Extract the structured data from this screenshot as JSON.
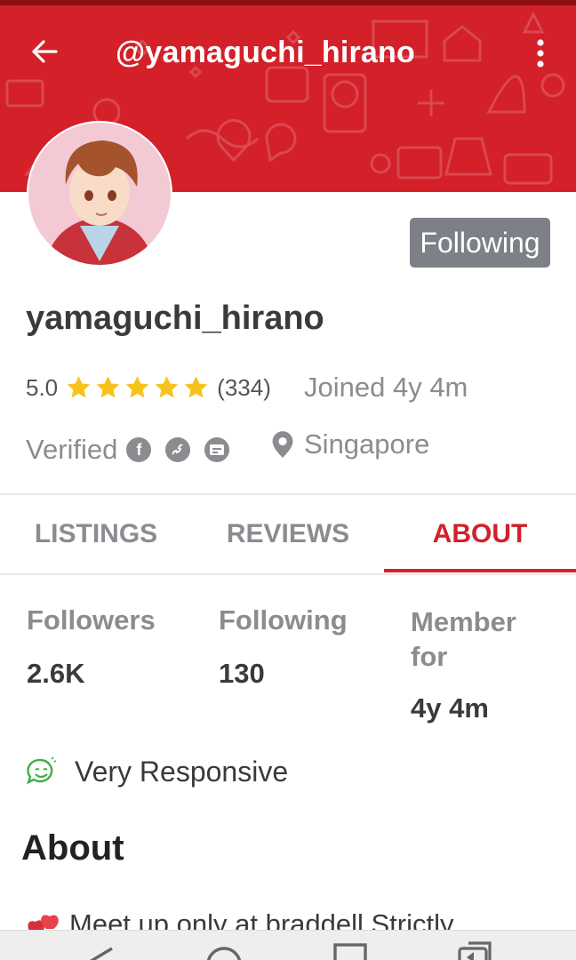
{
  "header": {
    "title": "@yamaguchi_hirano",
    "back_icon": "back-arrow-icon",
    "more_icon": "more-vertical-icon",
    "background_color": "#d32029"
  },
  "profile": {
    "follow_button_label": "Following",
    "username": "yamaguchi_hirano",
    "rating": "5.0",
    "stars": 5,
    "rating_count": "(334)",
    "joined": "Joined 4y 4m",
    "verified_label": "Verified",
    "verified_icons": [
      "facebook-icon",
      "phone-icon",
      "email-icon"
    ],
    "location": "Singapore",
    "star_color": "#f7c21b"
  },
  "tabs": [
    {
      "label": "LISTINGS",
      "active": false
    },
    {
      "label": "REVIEWS",
      "active": false
    },
    {
      "label": "ABOUT",
      "active": true
    }
  ],
  "stats": [
    {
      "label": "Followers",
      "value": "2.6K"
    },
    {
      "label": "Following",
      "value": "130"
    },
    {
      "label": "Member for",
      "value": "4y 4m"
    }
  ],
  "responsive": {
    "label": "Very Responsive",
    "icon": "smiley-chat-icon"
  },
  "about": {
    "heading": "About",
    "text": "Meet up only at braddell Strictly",
    "text_icon": "hearts-icon"
  },
  "navbar": {
    "icons": [
      "nav-back-icon",
      "nav-home-icon",
      "nav-recents-icon",
      "nav-switch-icon"
    ]
  }
}
